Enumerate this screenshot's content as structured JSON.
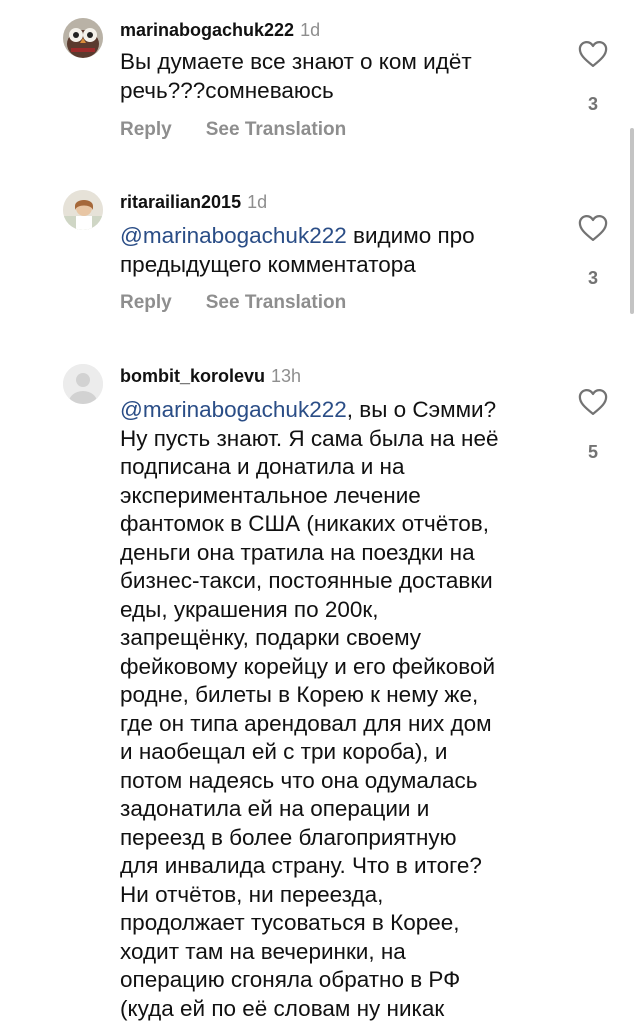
{
  "comments": [
    {
      "username": "marinabogachuk222",
      "time": "1d",
      "mention": "",
      "text": "Вы думаете все знают о ком идёт\nречь???сомневаюсь",
      "likes": "3",
      "reply": "Reply",
      "translate": "See Translation"
    },
    {
      "username": "ritarailian2015",
      "time": "1d",
      "mention": "@marinabogachuk222",
      "text": " видимо про\nпредыдущего комментатора",
      "likes": "3",
      "reply": "Reply",
      "translate": "See Translation"
    },
    {
      "username": "bombit_korolevu",
      "time": "13h",
      "mention": "@marinabogachuk222",
      "text": ", вы о Сэмми?\nНу пусть знают. Я сама была на неё\nподписана и донатила и на\nэкспериментальное лечение\nфантомок в США (никаких отчётов,\nденьги она тратила на поездки на\nбизнес-такси, постоянные доставки\nеды, украшения по 200к,\nзапрещёнку, подарки своему\nфейковому корейцу и его фейковой\nродне, билеты в Корею к нему же,\nгде он типа арендовал для них дом\nи наобещал ей с три короба), и\nпотом надеясь что она одумалась\nзадонатила ей на операции и\nпереезд в более благоприятную\nдля инвалида страну. Что в итоге?\nНи отчётов, ни переезда,\nпродолжает тусоваться в Корее,\nходит там на вечеринки, на\nоперацию сгоняла обратно в РФ\n(куда ей по её словам ну никак",
      "likes": "5",
      "reply": "",
      "translate": ""
    }
  ],
  "icons": {
    "like": "heart-outline-icon"
  },
  "colors": {
    "mention": "#2a4d86",
    "muted": "#8e8e8e",
    "text": "#111111"
  }
}
